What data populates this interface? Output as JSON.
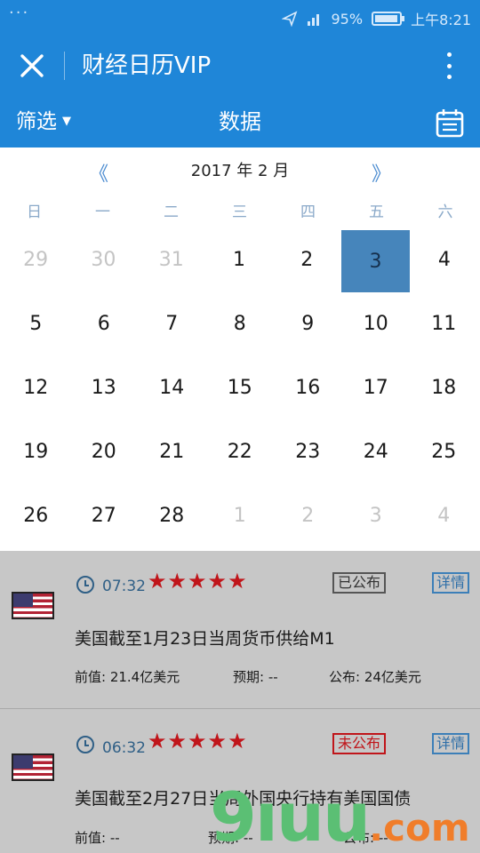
{
  "status_bar": {
    "dots": "···",
    "signal": "📶",
    "battery": "95%",
    "battery_level": 0.95,
    "time": "上午8:21"
  },
  "app_bar": {
    "title": "财经日历VIP",
    "close_icon": "close-icon",
    "more_icon": "more-vertical-icon"
  },
  "tab_bar": {
    "filter": "筛选",
    "title": "数据",
    "calendar_icon": "calendar-icon"
  },
  "calendar": {
    "prev": "《",
    "next": "》",
    "month": "2017 年 2 月",
    "weekdays": [
      "日",
      "一",
      "二",
      "三",
      "四",
      "五",
      "六"
    ],
    "weeks": [
      [
        {
          "d": "29",
          "m": true
        },
        {
          "d": "30",
          "m": true
        },
        {
          "d": "31",
          "m": true
        },
        {
          "d": "1"
        },
        {
          "d": "2"
        },
        {
          "d": "3",
          "s": true
        },
        {
          "d": "4"
        }
      ],
      [
        {
          "d": "5"
        },
        {
          "d": "6"
        },
        {
          "d": "7"
        },
        {
          "d": "8"
        },
        {
          "d": "9"
        },
        {
          "d": "10"
        },
        {
          "d": "11"
        }
      ],
      [
        {
          "d": "12"
        },
        {
          "d": "13"
        },
        {
          "d": "14"
        },
        {
          "d": "15"
        },
        {
          "d": "16"
        },
        {
          "d": "17"
        },
        {
          "d": "18"
        }
      ],
      [
        {
          "d": "19"
        },
        {
          "d": "20"
        },
        {
          "d": "21"
        },
        {
          "d": "22"
        },
        {
          "d": "23"
        },
        {
          "d": "24"
        },
        {
          "d": "25"
        }
      ],
      [
        {
          "d": "26"
        },
        {
          "d": "27"
        },
        {
          "d": "28"
        },
        {
          "d": "1",
          "m": true
        },
        {
          "d": "2",
          "m": true
        },
        {
          "d": "3",
          "m": true
        },
        {
          "d": "4",
          "m": true
        }
      ]
    ]
  },
  "events": [
    {
      "time": "07:32",
      "stars": "★★★★★",
      "status": "已公布",
      "detail": "详情",
      "title": "美国截至1月23日当周货币供给M1",
      "prev": "前值: 21.4亿美元",
      "forecast": "预期: --",
      "actual": "公布: 24亿美元"
    },
    {
      "time": "06:32",
      "stars": "★★★★★",
      "status": "未公布",
      "detail": "详情",
      "title": "美国截至2月27日当周外国央行持有美国国债",
      "prev": "前值: --",
      "forecast": "预期: --",
      "actual": "公布: --"
    }
  ],
  "watermark": {
    "main": "9ıuu",
    "suffix": ".com"
  },
  "colors": {
    "primary": "#1f86d8",
    "selected_day": "#4685bb",
    "star": "#c0151a"
  }
}
